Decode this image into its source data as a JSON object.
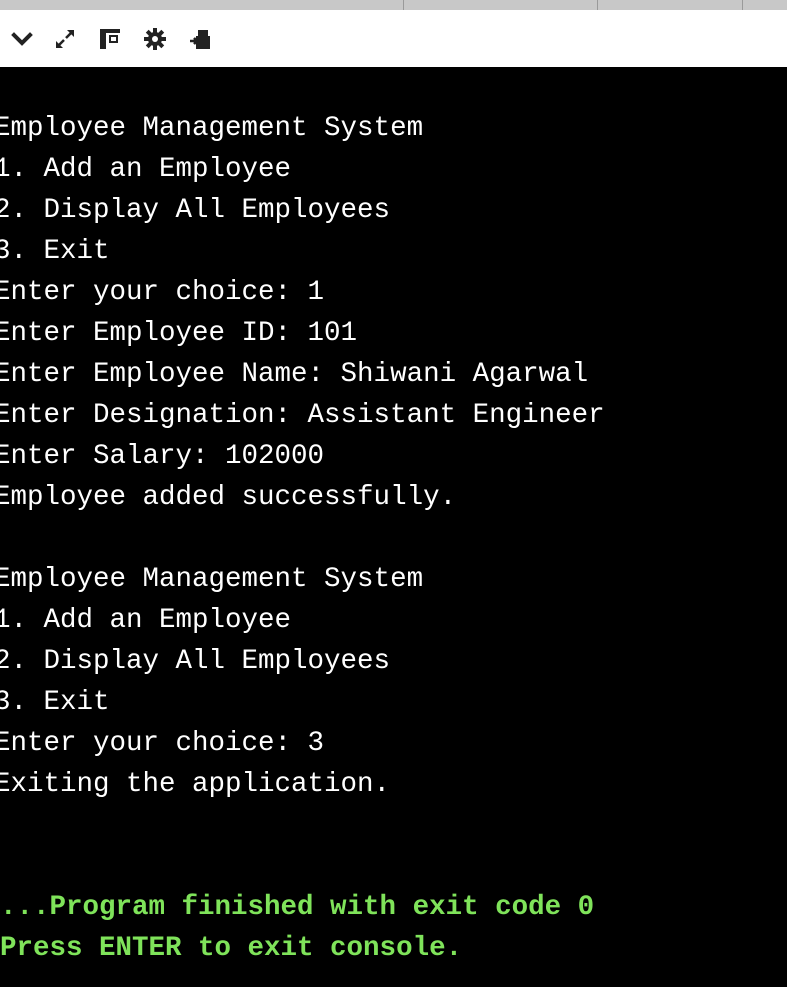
{
  "toolbar": {
    "icons": [
      "chevron-down-icon",
      "expand-icon",
      "layout-icon",
      "gear-icon",
      "share-icon"
    ]
  },
  "console": {
    "lines": [
      "Employee Management System",
      "1. Add an Employee",
      "2. Display All Employees",
      "3. Exit",
      "Enter your choice: 1",
      "Enter Employee ID: 101",
      "Enter Employee Name: Shiwani Agarwal",
      "Enter Designation: Assistant Engineer",
      "Enter Salary: 102000",
      "Employee added successfully.",
      "",
      "Employee Management System",
      "1. Add an Employee",
      "2. Display All Employees",
      "3. Exit",
      "Enter your choice: 3",
      "Exiting the application."
    ],
    "status_lines": [
      "...Program finished with exit code 0",
      "Press ENTER to exit console."
    ]
  },
  "colors": {
    "background": "#000000",
    "text": "#ffffff",
    "status": "#7fe35a",
    "toolbar": "#ffffff"
  }
}
